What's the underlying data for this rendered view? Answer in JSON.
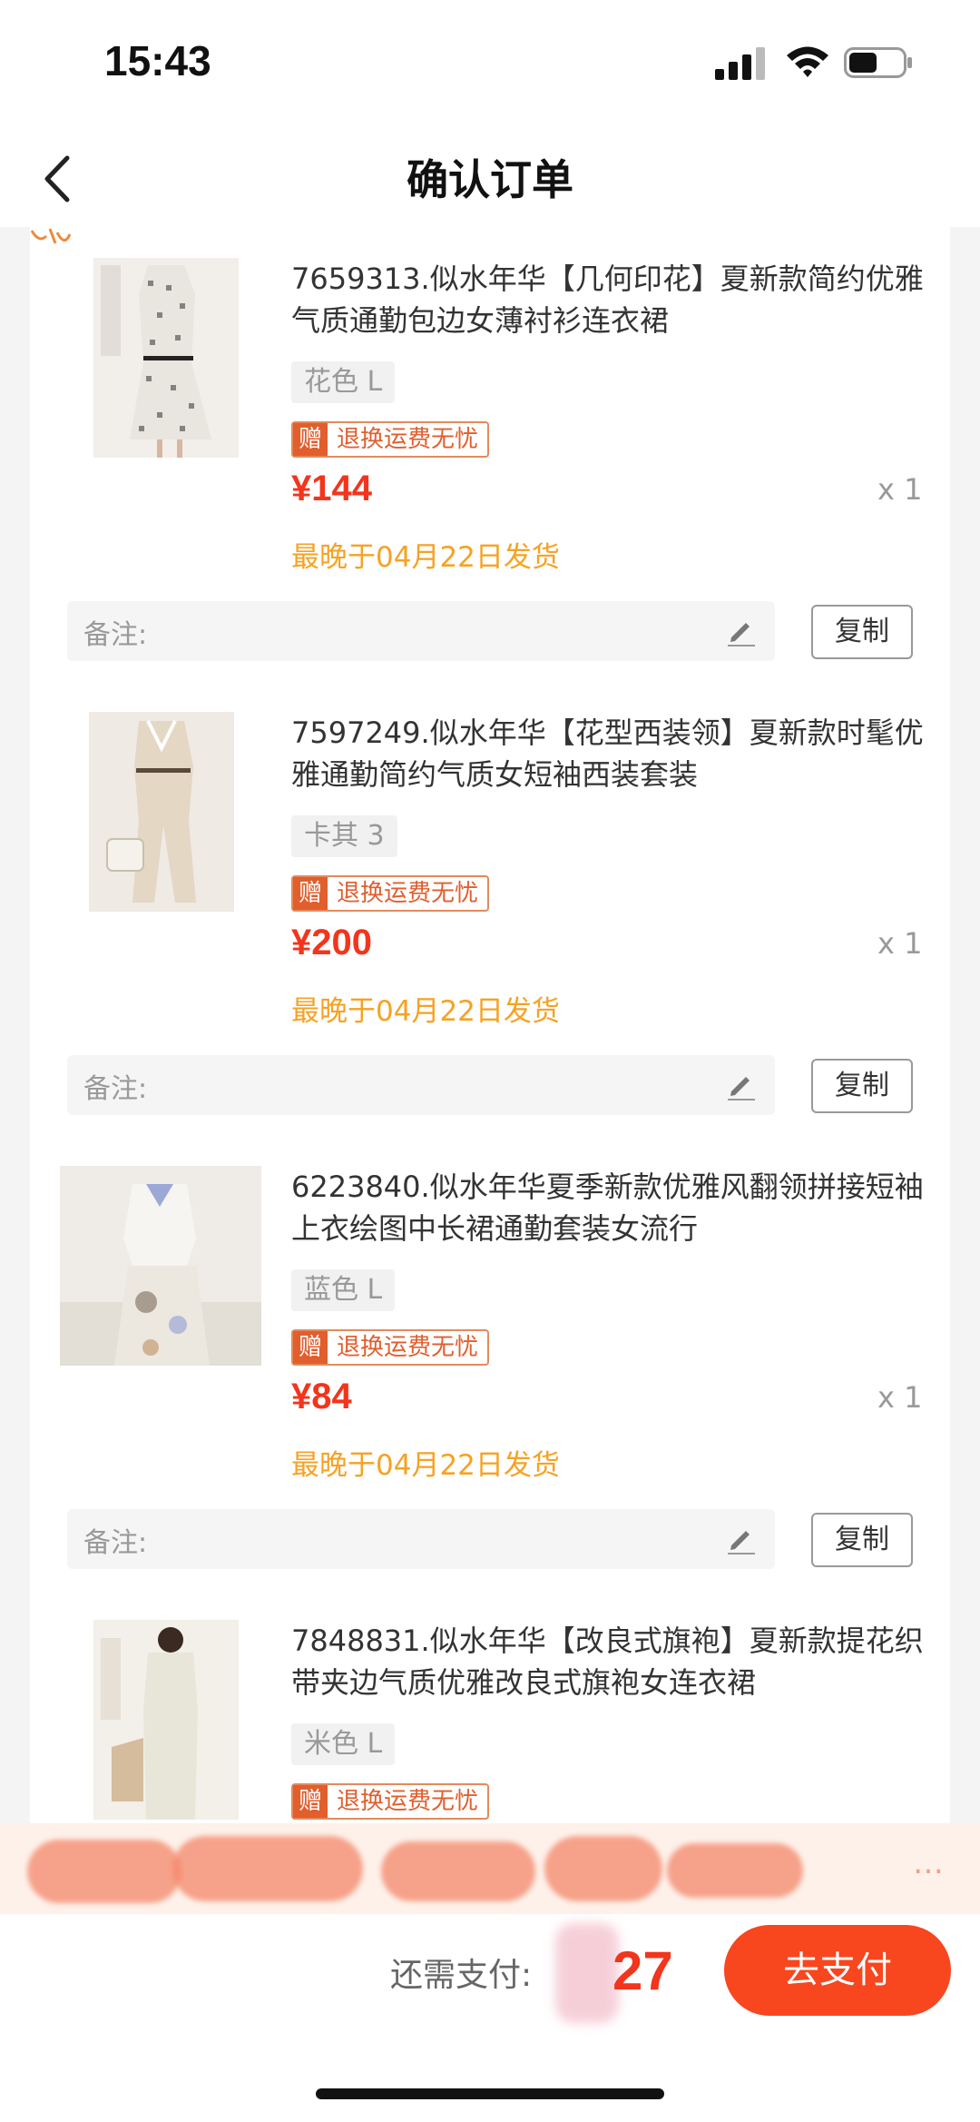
{
  "status_bar": {
    "time": "15:43"
  },
  "header": {
    "title": "确认订单"
  },
  "items": [
    {
      "name": "7659313.似水年华【几何印花】夏新款简约优雅气质通勤包边女薄衬衫连衣裙",
      "spec": "花色  L",
      "gift_tag": "赠",
      "gift_text": "退换运费无忧",
      "price": "¥144",
      "qty": "x 1",
      "ship": "最晚于04月22日发货",
      "note_label": "备注:",
      "copy_label": "复制"
    },
    {
      "name": "7597249.似水年华【花型西装领】夏新款时髦优雅通勤简约气质女短袖西装套装",
      "spec": "卡其  3",
      "gift_tag": "赠",
      "gift_text": "退换运费无忧",
      "price": "¥200",
      "qty": "x 1",
      "ship": "最晚于04月22日发货",
      "note_label": "备注:",
      "copy_label": "复制"
    },
    {
      "name": "6223840.似水年华夏季新款优雅风翻领拼接短袖上衣绘图中长裙通勤套装女流行",
      "spec": "蓝色  L",
      "gift_tag": "赠",
      "gift_text": "退换运费无忧",
      "price": "¥84",
      "qty": "x 1",
      "ship": "最晚于04月22日发货",
      "note_label": "备注:",
      "copy_label": "复制"
    },
    {
      "name": "7848831.似水年华【改良式旗袍】夏新款提花织带夹边气质优雅改良式旗袍女连衣裙",
      "spec": "米色  L",
      "gift_tag": "赠",
      "gift_text": "退换运费无忧"
    }
  ],
  "banner": {
    "text": "…"
  },
  "footer": {
    "pay_label": "还需支付:",
    "pay_amount": "27",
    "pay_button": "去支付"
  },
  "colors": {
    "price": "#f2351c",
    "ship": "#f6a223",
    "button": "#f8461f"
  }
}
